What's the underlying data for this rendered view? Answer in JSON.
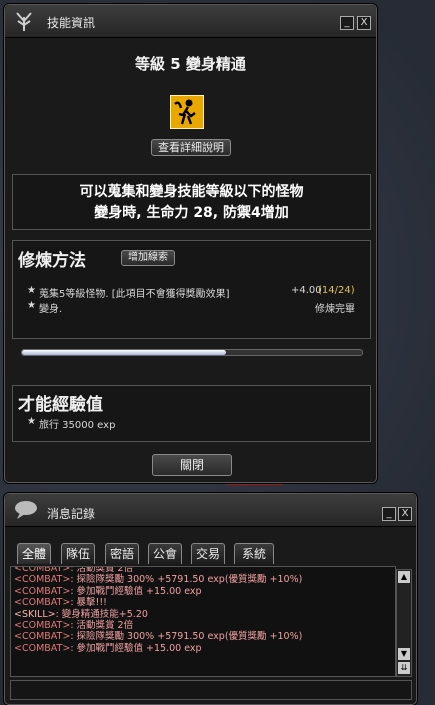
{
  "skill_window": {
    "title": "技能資訊",
    "minimize": "_",
    "close": "X",
    "heading": "等級 5 變身精通",
    "detail_button": "查看詳細說明",
    "description": [
      "可以蒐集和變身技能等級以下的怪物",
      "變身時, 生命力 28, 防禦4增加"
    ],
    "training_header": "修煉方法",
    "add_clue_button": "增加線索",
    "training_items": [
      {
        "text": "蒐集5等級怪物. [此項目不會獲得獎勵效果]",
        "reward": "+4.00",
        "progress": "(14/24)"
      },
      {
        "text": "變身.",
        "reward": "",
        "progress": "修煉完畢"
      }
    ],
    "progress_fraction": 0.6,
    "talent_header": "才能經驗值",
    "talent_item": "旅行 35000 exp",
    "close_button": "關閉"
  },
  "log_window": {
    "title": "消息記錄",
    "minimize": "_",
    "close": "X",
    "tabs": [
      "全體",
      "隊伍",
      "密語",
      "公會",
      "交易",
      "系統"
    ],
    "lines": [
      {
        "tag": "<COMBAT>",
        "text": ": 活動獎賞 2倍"
      },
      {
        "tag": "<COMBAT>",
        "text": ": 探險隊獎勵 300% +5791.50 exp(優質獎勵 +10%)"
      },
      {
        "tag": "<COMBAT>",
        "text": ": 參加戰鬥經驗值 +15.00 exp"
      },
      {
        "tag": "<COMBAT>",
        "text": ": 暴擊!!!"
      },
      {
        "tag": "<SKILL>",
        "text": ": 變身精通技能+5.20"
      },
      {
        "tag": "<COMBAT>",
        "text": ": 活動獎賞 2倍"
      },
      {
        "tag": "<COMBAT>",
        "text": ": 探險隊獎勵 300% +5791.50 exp(優質獎勵 +10%)"
      },
      {
        "tag": "<COMBAT>",
        "text": ": 參加戰鬥經驗值 +15.00 exp"
      }
    ]
  },
  "colors": {
    "log_text": "#f0a0a0",
    "skill_icon_bg": "#e8a800",
    "progress": "#c8d0e8"
  }
}
